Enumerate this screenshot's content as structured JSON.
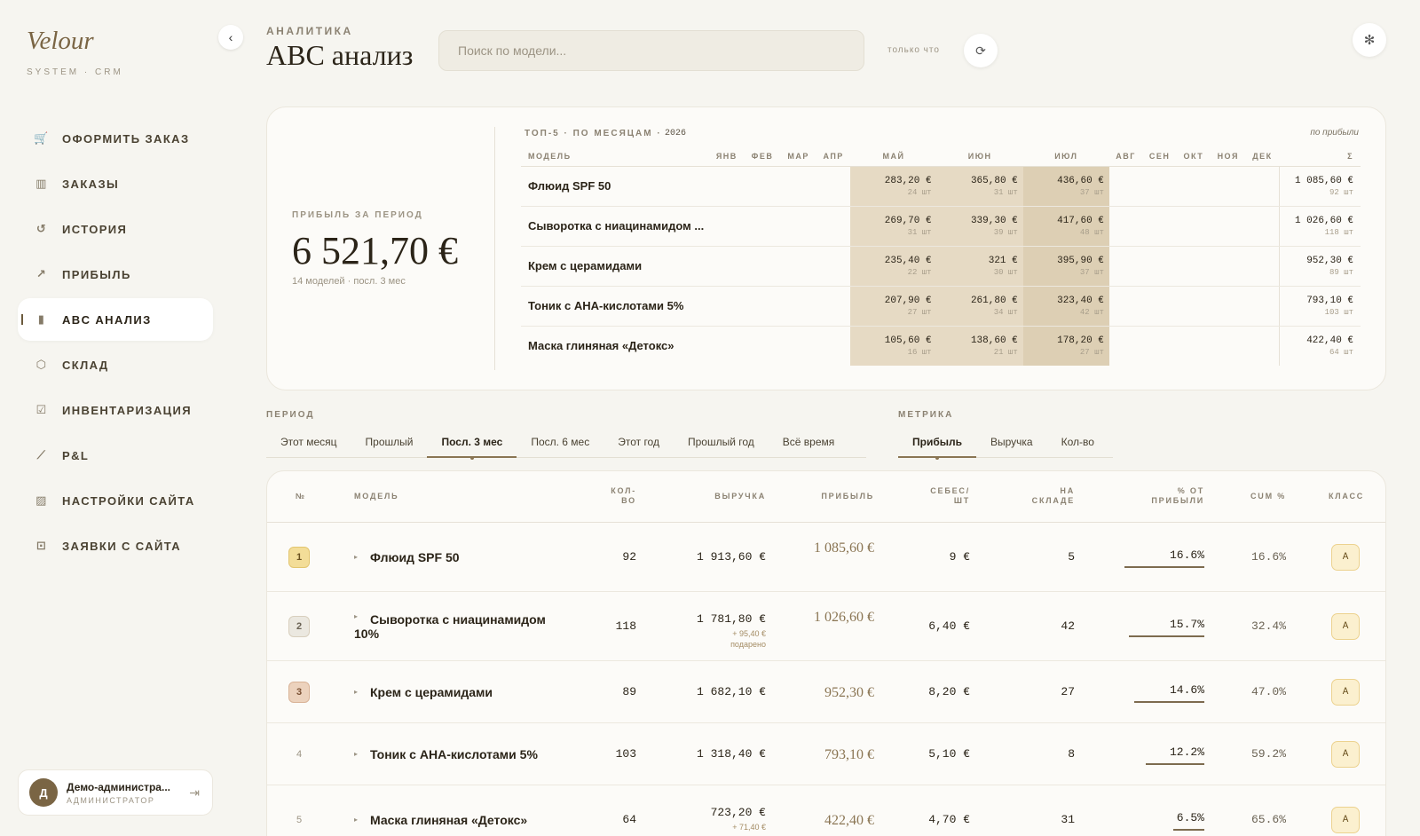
{
  "brand": {
    "name": "Velour",
    "sub": "SYSTEM · CRM"
  },
  "nav": [
    {
      "label": "ОФОРМИТЬ ЗАКАЗ",
      "icon": "cart-icon",
      "glyph": "🛒",
      "active": false
    },
    {
      "label": "ЗАКАЗЫ",
      "icon": "kanban-icon",
      "glyph": "▥",
      "active": false
    },
    {
      "label": "ИСТОРИЯ",
      "icon": "history-icon",
      "glyph": "↺",
      "active": false
    },
    {
      "label": "ПРИБЫЛЬ",
      "icon": "trend-up-icon",
      "glyph": "↗",
      "active": false
    },
    {
      "label": "ABC АНАЛИЗ",
      "icon": "bar-chart-icon",
      "glyph": "▮",
      "active": true
    },
    {
      "label": "СКЛАД",
      "icon": "box-icon",
      "glyph": "⬡",
      "active": false
    },
    {
      "label": "ИНВЕНТАРИЗАЦИЯ",
      "icon": "checkbox-icon",
      "glyph": "☑",
      "active": false
    },
    {
      "label": "P&L",
      "icon": "line-chart-icon",
      "glyph": "⟋",
      "active": false
    },
    {
      "label": "НАСТРОЙКИ САЙТА",
      "icon": "image-icon",
      "glyph": "▨",
      "active": false
    },
    {
      "label": "ЗАЯВКИ С САЙТА",
      "icon": "bag-icon",
      "glyph": "⊡",
      "active": false
    }
  ],
  "user": {
    "initial": "Д",
    "name": "Демо-администра...",
    "role": "АДМИНИСТРАТОР"
  },
  "header": {
    "kicker": "АНАЛИТИКА",
    "title": "ABC анализ",
    "search_placeholder": "Поиск по модели...",
    "updated": "только что"
  },
  "summary": {
    "label": "ПРИБЫЛЬ ЗА ПЕРИОД",
    "value": "6 521,70 €",
    "sub": "14 моделей · посл. 3 мес"
  },
  "top5": {
    "title": "ТОП-5 · ПО МЕСЯЦАМ ·",
    "year": "2026",
    "sort_label": "по прибыли",
    "model_header": "МОДЕЛЬ",
    "months": [
      "ЯНВ",
      "ФЕВ",
      "МАР",
      "АПР",
      "МАЙ",
      "ИЮН",
      "ИЮЛ",
      "АВГ",
      "СЕН",
      "ОКТ",
      "НОЯ",
      "ДЕК"
    ],
    "sum_header": "Σ",
    "rows": [
      {
        "model": "Флюид SPF 50",
        "may": "283,20 €",
        "may_q": "24 шт",
        "jun": "365,80 €",
        "jun_q": "31 шт",
        "jul": "436,60 €",
        "jul_q": "37 шт",
        "sum": "1 085,60 €",
        "sum_q": "92 шт"
      },
      {
        "model": "Сыворотка с ниацинамидом ...",
        "may": "269,70 €",
        "may_q": "31 шт",
        "jun": "339,30 €",
        "jun_q": "39 шт",
        "jul": "417,60 €",
        "jul_q": "48 шт",
        "sum": "1 026,60 €",
        "sum_q": "118 шт"
      },
      {
        "model": "Крем с церамидами",
        "may": "235,40 €",
        "may_q": "22 шт",
        "jun": "321 €",
        "jun_q": "30 шт",
        "jul": "395,90 €",
        "jul_q": "37 шт",
        "sum": "952,30 €",
        "sum_q": "89 шт"
      },
      {
        "model": "Тоник с AHA-кислотами 5%",
        "may": "207,90 €",
        "may_q": "27 шт",
        "jun": "261,80 €",
        "jun_q": "34 шт",
        "jul": "323,40 €",
        "jul_q": "42 шт",
        "sum": "793,10 €",
        "sum_q": "103 шт"
      },
      {
        "model": "Маска глиняная «Детокс»",
        "may": "105,60 €",
        "may_q": "16 шт",
        "jun": "138,60 €",
        "jun_q": "21 шт",
        "jul": "178,20 €",
        "jul_q": "27 шт",
        "sum": "422,40 €",
        "sum_q": "64 шт"
      }
    ]
  },
  "period": {
    "label": "ПЕРИОД",
    "options": [
      "Этот месяц",
      "Прошлый",
      "Посл. 3 мес",
      "Посл. 6 мес",
      "Этот год",
      "Прошлый год",
      "Всё время"
    ],
    "selected": "Посл. 3 мес"
  },
  "metric": {
    "label": "МЕТРИКА",
    "options": [
      "Прибыль",
      "Выручка",
      "Кол-во"
    ],
    "selected": "Прибыль"
  },
  "table": {
    "headers": {
      "num": "№",
      "model": "МОДЕЛЬ",
      "qty1": "КОЛ-",
      "qty2": "ВО",
      "revenue": "ВЫРУЧКА",
      "profit": "ПРИБЫЛЬ",
      "cost1": "СЕБЕС/",
      "cost2": "ШТ",
      "stock1": "НА",
      "stock2": "СКЛАДЕ",
      "share1": "% ОТ",
      "share2": "ПРИБЫЛИ",
      "cum": "CUM %",
      "cls": "КЛАСС"
    },
    "rows": [
      {
        "rank": "1",
        "model": "Флюид SPF 50",
        "qty": "92",
        "revenue": "1 913,60 €",
        "gift": "",
        "gift2": "",
        "profit": "1 085,60 €",
        "cost": "9 €",
        "stock": "5",
        "share": "16.6%",
        "share_value": 16.6,
        "cum": "16.6%",
        "cls": "A"
      },
      {
        "rank": "2",
        "model": "Сыворотка с ниацинамидом 10%",
        "qty": "118",
        "revenue": "1 781,80 €",
        "gift": "+ 95,40 €",
        "gift2": "подарено",
        "profit": "1 026,60 €",
        "cost": "6,40 €",
        "stock": "42",
        "share": "15.7%",
        "share_value": 15.7,
        "cum": "32.4%",
        "cls": "A"
      },
      {
        "rank": "3",
        "model": "Крем с церамидами",
        "qty": "89",
        "revenue": "1 682,10 €",
        "gift": "",
        "gift2": "",
        "profit": "952,30 €",
        "cost": "8,20 €",
        "stock": "27",
        "share": "14.6%",
        "share_value": 14.6,
        "cum": "47.0%",
        "cls": "A"
      },
      {
        "rank": "4",
        "model": "Тоник с AHA-кислотами 5%",
        "qty": "103",
        "revenue": "1 318,40 €",
        "gift": "",
        "gift2": "",
        "profit": "793,10 €",
        "cost": "5,10 €",
        "stock": "8",
        "share": "12.2%",
        "share_value": 12.2,
        "cum": "59.2%",
        "cls": "A"
      },
      {
        "rank": "5",
        "model": "Маска глиняная «Детокс»",
        "qty": "64",
        "revenue": "723,20 €",
        "gift": "+ 71,40 €",
        "gift2": "",
        "profit": "422,40 €",
        "cost": "4,70 €",
        "stock": "31",
        "share": "6.5%",
        "share_value": 6.5,
        "cum": "65.6%",
        "cls": "A"
      }
    ]
  }
}
